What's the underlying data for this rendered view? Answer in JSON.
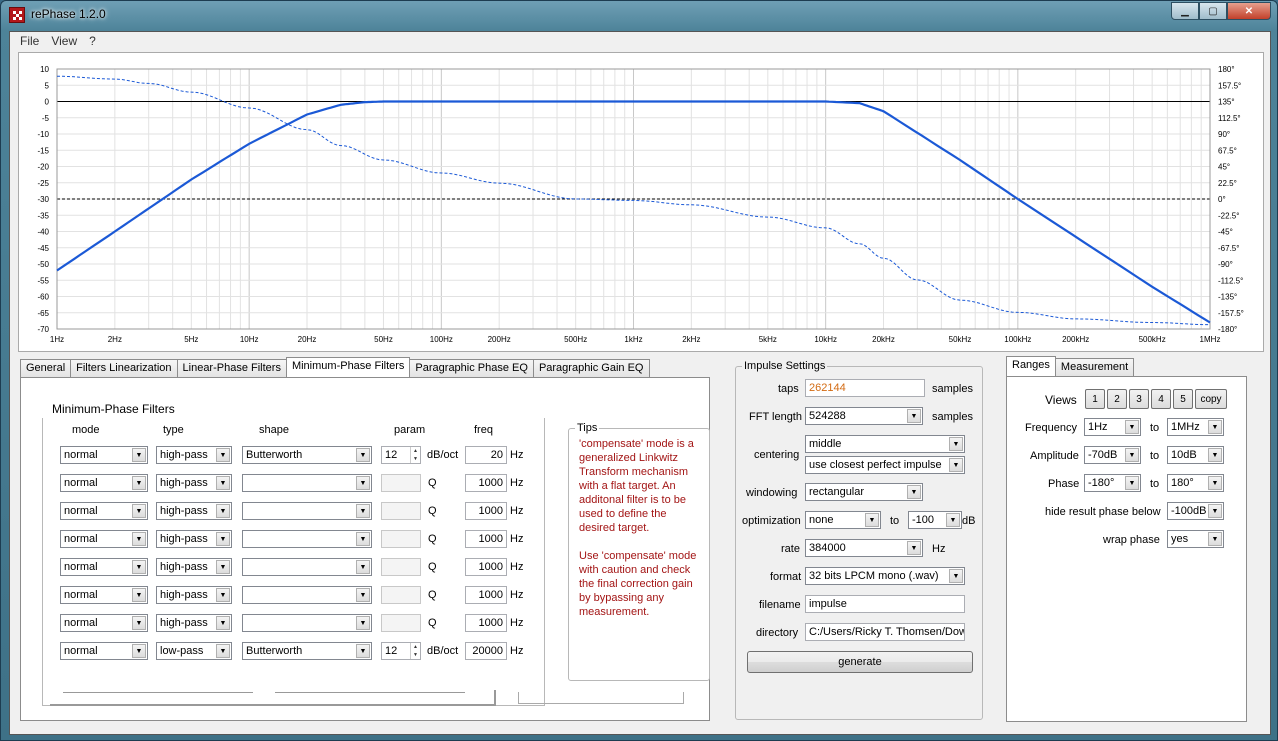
{
  "window": {
    "title": "rePhase 1.2.0"
  },
  "menu": [
    "File",
    "View",
    "?"
  ],
  "chart": {
    "left_ticks": [
      "10",
      "5",
      "0",
      "-5",
      "-10",
      "-15",
      "-20",
      "-25",
      "-30",
      "-35",
      "-40",
      "-45",
      "-50",
      "-55",
      "-60",
      "-65",
      "-70"
    ],
    "right_ticks": [
      "180°",
      "157.5°",
      "135°",
      "112.5°",
      "90°",
      "67.5°",
      "45°",
      "22.5°",
      "0°",
      "-22.5°",
      "-45°",
      "-67.5°",
      "-90°",
      "-112.5°",
      "-135°",
      "-157.5°",
      "-180°"
    ],
    "x_ticks": [
      "1Hz",
      "2Hz",
      "5Hz",
      "10Hz",
      "20Hz",
      "50Hz",
      "100Hz",
      "200Hz",
      "500Hz",
      "1kHz",
      "2kHz",
      "5kHz",
      "10kHz",
      "20kHz",
      "50kHz",
      "100kHz",
      "200kHz",
      "500kHz",
      "1MHz"
    ]
  },
  "chart_data": {
    "type": "line",
    "x_scale": "log",
    "xlim": [
      1,
      1000000
    ],
    "ylim": [
      -70,
      10
    ],
    "y2lim": [
      -180,
      180
    ],
    "series": [
      {
        "axis": "left",
        "style": "solid",
        "x": [
          1,
          2,
          5,
          10,
          20,
          30,
          40,
          50,
          100,
          1000,
          5000,
          10000,
          15000,
          20000,
          50000,
          100000,
          500000,
          1000000
        ],
        "y": [
          -52,
          -40,
          -24,
          -13,
          -4,
          -1,
          -0.2,
          0,
          0,
          0,
          0,
          0,
          -0.5,
          -3,
          -18,
          -30,
          -57,
          -68
        ]
      },
      {
        "axis": "right",
        "style": "dashed",
        "x": [
          1,
          2,
          3,
          5,
          10,
          20,
          30,
          50,
          100,
          200,
          500,
          1000,
          2000,
          5000,
          10000,
          15000,
          20000,
          30000,
          50000,
          100000,
          200000,
          500000,
          1000000
        ],
        "y": [
          170,
          166,
          160,
          148,
          126,
          96,
          74,
          54,
          36,
          22,
          0,
          -2,
          -8,
          -25,
          -40,
          -62,
          -82,
          -112,
          -140,
          -157,
          -166,
          -171,
          -174
        ]
      }
    ]
  },
  "tabs": {
    "left": [
      "General",
      "Filters Linearization",
      "Linear-Phase Filters",
      "Minimum-Phase Filters",
      "Paragraphic Phase EQ",
      "Paragraphic Gain EQ"
    ],
    "right": [
      "Ranges",
      "Measurement"
    ]
  },
  "minphase": {
    "group_title": "Minimum-Phase Filters",
    "headers": {
      "mode": "mode",
      "type": "type",
      "shape": "shape",
      "param": "param",
      "freq": "freq"
    },
    "hz_unit": "Hz",
    "rows": [
      {
        "mode": "normal",
        "type": "high-pass",
        "shape": "Butterworth",
        "param": "12",
        "unit": "dB/oct",
        "freq": "20",
        "enabled": true
      },
      {
        "mode": "normal",
        "type": "high-pass",
        "shape": "",
        "param": "",
        "unit": "Q",
        "freq": "1000",
        "enabled": false
      },
      {
        "mode": "normal",
        "type": "high-pass",
        "shape": "",
        "param": "",
        "unit": "Q",
        "freq": "1000",
        "enabled": false
      },
      {
        "mode": "normal",
        "type": "high-pass",
        "shape": "",
        "param": "",
        "unit": "Q",
        "freq": "1000",
        "enabled": false
      },
      {
        "mode": "normal",
        "type": "high-pass",
        "shape": "",
        "param": "",
        "unit": "Q",
        "freq": "1000",
        "enabled": false
      },
      {
        "mode": "normal",
        "type": "high-pass",
        "shape": "",
        "param": "",
        "unit": "Q",
        "freq": "1000",
        "enabled": false
      },
      {
        "mode": "normal",
        "type": "high-pass",
        "shape": "",
        "param": "",
        "unit": "Q",
        "freq": "1000",
        "enabled": false
      },
      {
        "mode": "normal",
        "type": "low-pass",
        "shape": "Butterworth",
        "param": "12",
        "unit": "dB/oct",
        "freq": "20000",
        "enabled": true
      }
    ]
  },
  "tips": {
    "title": "Tips",
    "p1": "'compensate' mode is a generalized Linkwitz Transform mechanism with a flat target. An additonal filter is to be used to define the desired target.",
    "p2": "Use 'compensate' mode with caution and check the final correction gain by bypassing any measurement."
  },
  "impulse": {
    "title": "Impulse Settings",
    "taps_label": "taps",
    "taps": "262144",
    "samples": "samples",
    "fft_label": "FFT length",
    "fft": "524288",
    "centering_label": "centering",
    "centering": "middle",
    "centering2": "use closest perfect impulse",
    "windowing_label": "windowing",
    "windowing": "rectangular",
    "optimization_label": "optimization",
    "optimization": "none",
    "to": "to",
    "opt_db": "-100",
    "db": "dB",
    "rate_label": "rate",
    "rate": "384000",
    "hz": "Hz",
    "format_label": "format",
    "format": "32 bits LPCM mono (.wav)",
    "filename_label": "filename",
    "filename": "impulse",
    "directory_label": "directory",
    "directory": "C:/Users/Ricky T. Thomsen/Dow",
    "generate": "generate"
  },
  "ranges": {
    "views_label": "Views",
    "views": [
      "1",
      "2",
      "3",
      "4",
      "5"
    ],
    "copy": "copy",
    "frequency_label": "Frequency",
    "freq_from": "1Hz",
    "freq_to": "1MHz",
    "amplitude_label": "Amplitude",
    "amp_from": "-70dB",
    "amp_to": "10dB",
    "phase_label": "Phase",
    "phase_from": "-180°",
    "phase_to": "180°",
    "to": "to",
    "hide_label": "hide result phase below",
    "hide": "-100dB",
    "wrap_label": "wrap phase",
    "wrap": "yes"
  }
}
